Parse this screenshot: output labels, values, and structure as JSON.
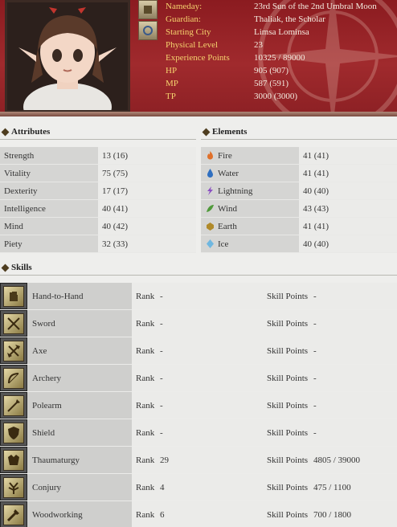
{
  "profile": {
    "rows": [
      {
        "label": "Nameday:",
        "value": "23rd Sun of the 2nd Umbral Moon"
      },
      {
        "label": "Guardian:",
        "value": "Thaliak, the Scholar"
      },
      {
        "label": "Starting City",
        "value": "Limsa Lominsa"
      },
      {
        "label": "Physical Level",
        "value": "23"
      },
      {
        "label": "Experience Points",
        "value": "10325 / 89000"
      },
      {
        "label": "HP",
        "value": "905 (907)"
      },
      {
        "label": "MP",
        "value": "587 (591)"
      },
      {
        "label": "TP",
        "value": "3000 (3000)"
      }
    ]
  },
  "attributes": {
    "title": "Attributes",
    "rows": [
      {
        "name": "Strength",
        "value": "13 (16)"
      },
      {
        "name": "Vitality",
        "value": "75 (75)"
      },
      {
        "name": "Dexterity",
        "value": "17 (17)"
      },
      {
        "name": "Intelligence",
        "value": "40 (41)"
      },
      {
        "name": "Mind",
        "value": "40 (42)"
      },
      {
        "name": "Piety",
        "value": "32 (33)"
      }
    ]
  },
  "elements": {
    "title": "Elements",
    "rows": [
      {
        "name": "Fire",
        "value": "41 (41)",
        "icon": "fire-icon",
        "color": "#e0702a"
      },
      {
        "name": "Water",
        "value": "41 (41)",
        "icon": "water-icon",
        "color": "#2f6fc0"
      },
      {
        "name": "Lightning",
        "value": "40 (40)",
        "icon": "lightning-icon",
        "color": "#8a4fc2"
      },
      {
        "name": "Wind",
        "value": "43 (43)",
        "icon": "wind-icon",
        "color": "#4f9a3a"
      },
      {
        "name": "Earth",
        "value": "41 (41)",
        "icon": "earth-icon",
        "color": "#b08a2a"
      },
      {
        "name": "Ice",
        "value": "40 (40)",
        "icon": "ice-icon",
        "color": "#6fb7e0"
      }
    ]
  },
  "skills": {
    "title": "Skills",
    "rank_label": "Rank",
    "points_label": "Skill Points",
    "rows": [
      {
        "name": "Hand-to-Hand",
        "rank": "-",
        "points": "-",
        "icon": "fist-icon"
      },
      {
        "name": "Sword",
        "rank": "-",
        "points": "-",
        "icon": "sword-icon"
      },
      {
        "name": "Axe",
        "rank": "-",
        "points": "-",
        "icon": "axe-icon"
      },
      {
        "name": "Archery",
        "rank": "-",
        "points": "-",
        "icon": "bow-icon"
      },
      {
        "name": "Polearm",
        "rank": "-",
        "points": "-",
        "icon": "polearm-icon"
      },
      {
        "name": "Shield",
        "rank": "-",
        "points": "-",
        "icon": "shield-icon"
      },
      {
        "name": "Thaumaturgy",
        "rank": "29",
        "points": "4805 / 39000",
        "icon": "thaumaturgy-icon"
      },
      {
        "name": "Conjury",
        "rank": "4",
        "points": "475 / 1100",
        "icon": "conjury-icon"
      },
      {
        "name": "Woodworking",
        "rank": "6",
        "points": "700 / 1800",
        "icon": "woodworking-icon"
      }
    ]
  }
}
